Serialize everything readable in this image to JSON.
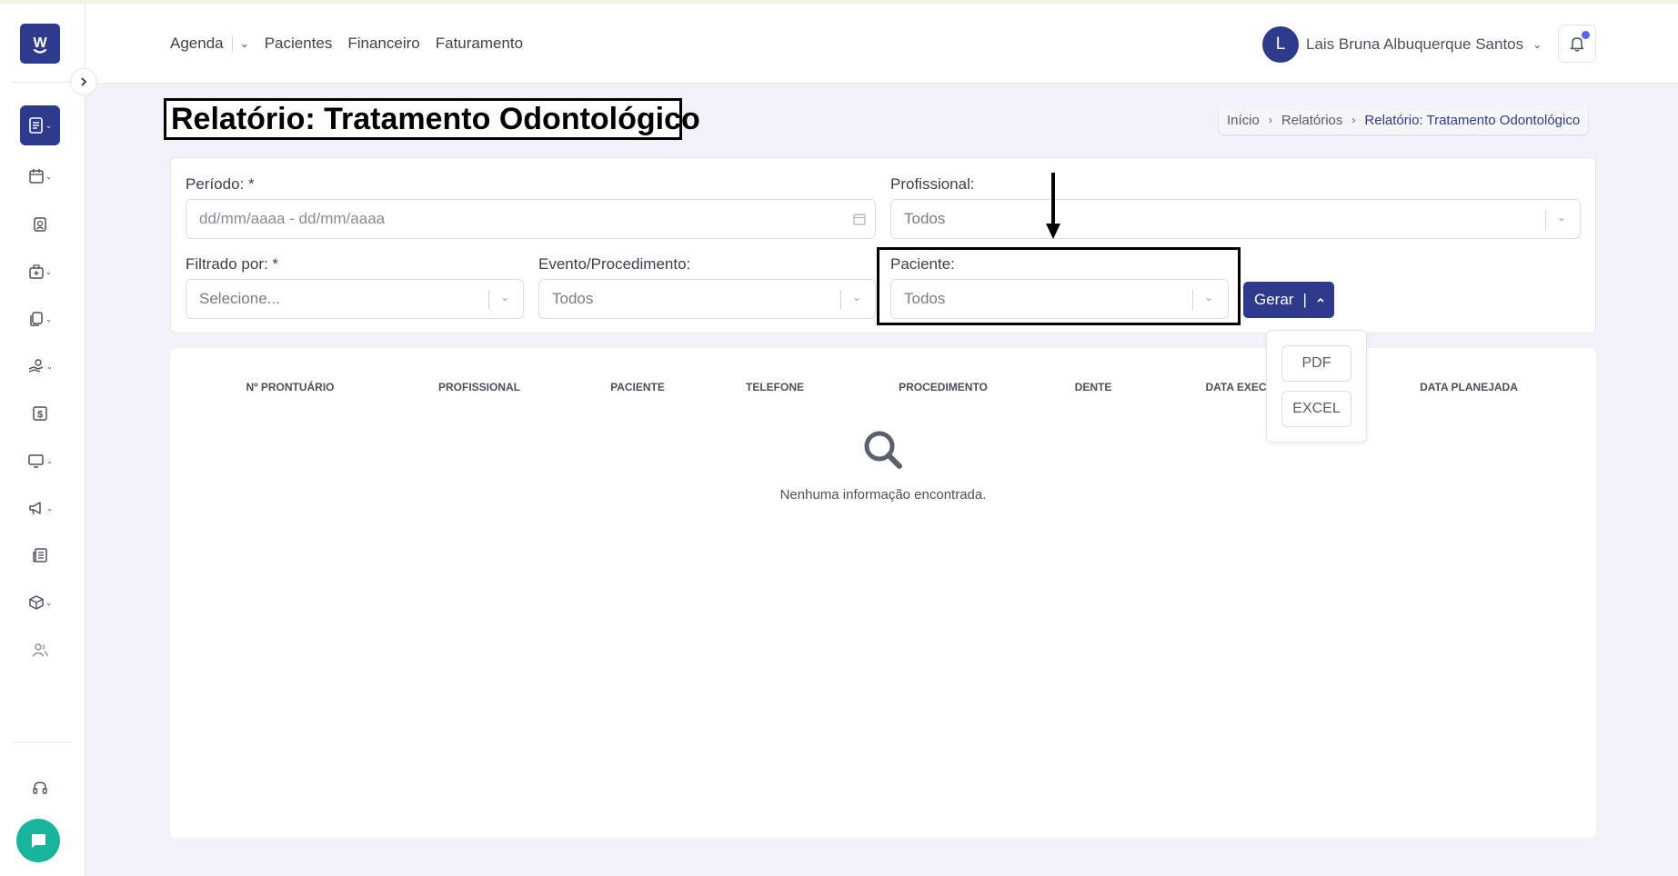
{
  "app": {
    "logo_letter": "W"
  },
  "topnav": {
    "agenda": "Agenda",
    "pacientes": "Pacientes",
    "financeiro": "Financeiro",
    "faturamento": "Faturamento"
  },
  "user": {
    "initial": "L",
    "name": "Lais Bruna Albuquerque Santos"
  },
  "page": {
    "title": "Relatório: Tratamento Odontológico"
  },
  "breadcrumb": {
    "items": [
      "Início",
      "Relatórios",
      "Relatório: Tratamento Odontológico"
    ]
  },
  "filters": {
    "periodo": {
      "label": "Período: *",
      "placeholder": "dd/mm/aaaa - dd/mm/aaaa"
    },
    "profissional": {
      "label": "Profissional:",
      "value": "Todos"
    },
    "filtrado_por": {
      "label": "Filtrado por: *",
      "value": "Selecione..."
    },
    "evento": {
      "label": "Evento/Procedimento:",
      "value": "Todos"
    },
    "paciente": {
      "label": "Paciente:",
      "value": "Todos"
    }
  },
  "gerar": {
    "label": "Gerar",
    "options": [
      "PDF",
      "EXCEL"
    ]
  },
  "table": {
    "columns": [
      "Nº PRONTUÁRIO",
      "PROFISSIONAL",
      "PACIENTE",
      "TELEFONE",
      "PROCEDIMENTO",
      "DENTE",
      "DATA EXEC",
      "DATA PLANEJADA"
    ],
    "empty_message": "Nenhuma informação encontrada."
  },
  "sidebar": {
    "icons": [
      "reports-icon",
      "calendar-icon",
      "patient-badge-icon",
      "clinic-icon",
      "documents-icon",
      "scale-hand-icon",
      "dollar-icon",
      "monitor-icon",
      "megaphone-icon",
      "newspaper-icon",
      "package-icon",
      "users-icon",
      "headset-icon"
    ]
  },
  "colors": {
    "primary": "#2e3a8c",
    "chat": "#1ab49d",
    "notification_dot": "#5866e8"
  }
}
